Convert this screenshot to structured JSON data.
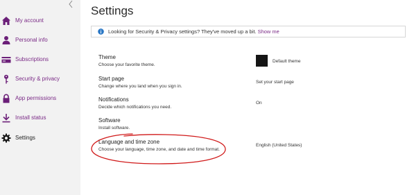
{
  "sidebar": {
    "items": [
      {
        "label": "My account",
        "icon": "home-icon"
      },
      {
        "label": "Personal info",
        "icon": "person-icon"
      },
      {
        "label": "Subscriptions",
        "icon": "card-icon"
      },
      {
        "label": "Security & privacy",
        "icon": "key-icon"
      },
      {
        "label": "App permissions",
        "icon": "lock-icon"
      },
      {
        "label": "Install status",
        "icon": "download-icon"
      },
      {
        "label": "Settings",
        "icon": "gear-icon"
      }
    ],
    "active_item": "Settings"
  },
  "main": {
    "title": "Settings",
    "banner": {
      "text": "Looking for Security & Privacy settings? They've moved up a bit.",
      "link": "Show me"
    },
    "settings": [
      {
        "title": "Theme",
        "description": "Choose your favorite theme.",
        "value": "Default theme"
      },
      {
        "title": "Start page",
        "description": "Change where you land when you sign in.",
        "value": "Set your start page"
      },
      {
        "title": "Notifications",
        "description": "Decide which notifications you need.",
        "value": "On"
      },
      {
        "title": "Software",
        "description": "Install software.",
        "value": ""
      },
      {
        "title": "Language and time zone",
        "description": "Choose your language, time zone, and date and time format.",
        "value": "English (United States)"
      }
    ]
  },
  "colors": {
    "accent": "#7a2a86",
    "sidebar_bg": "#f2f2f2",
    "annotation": "#d01818",
    "info_icon": "#2b78c5"
  }
}
